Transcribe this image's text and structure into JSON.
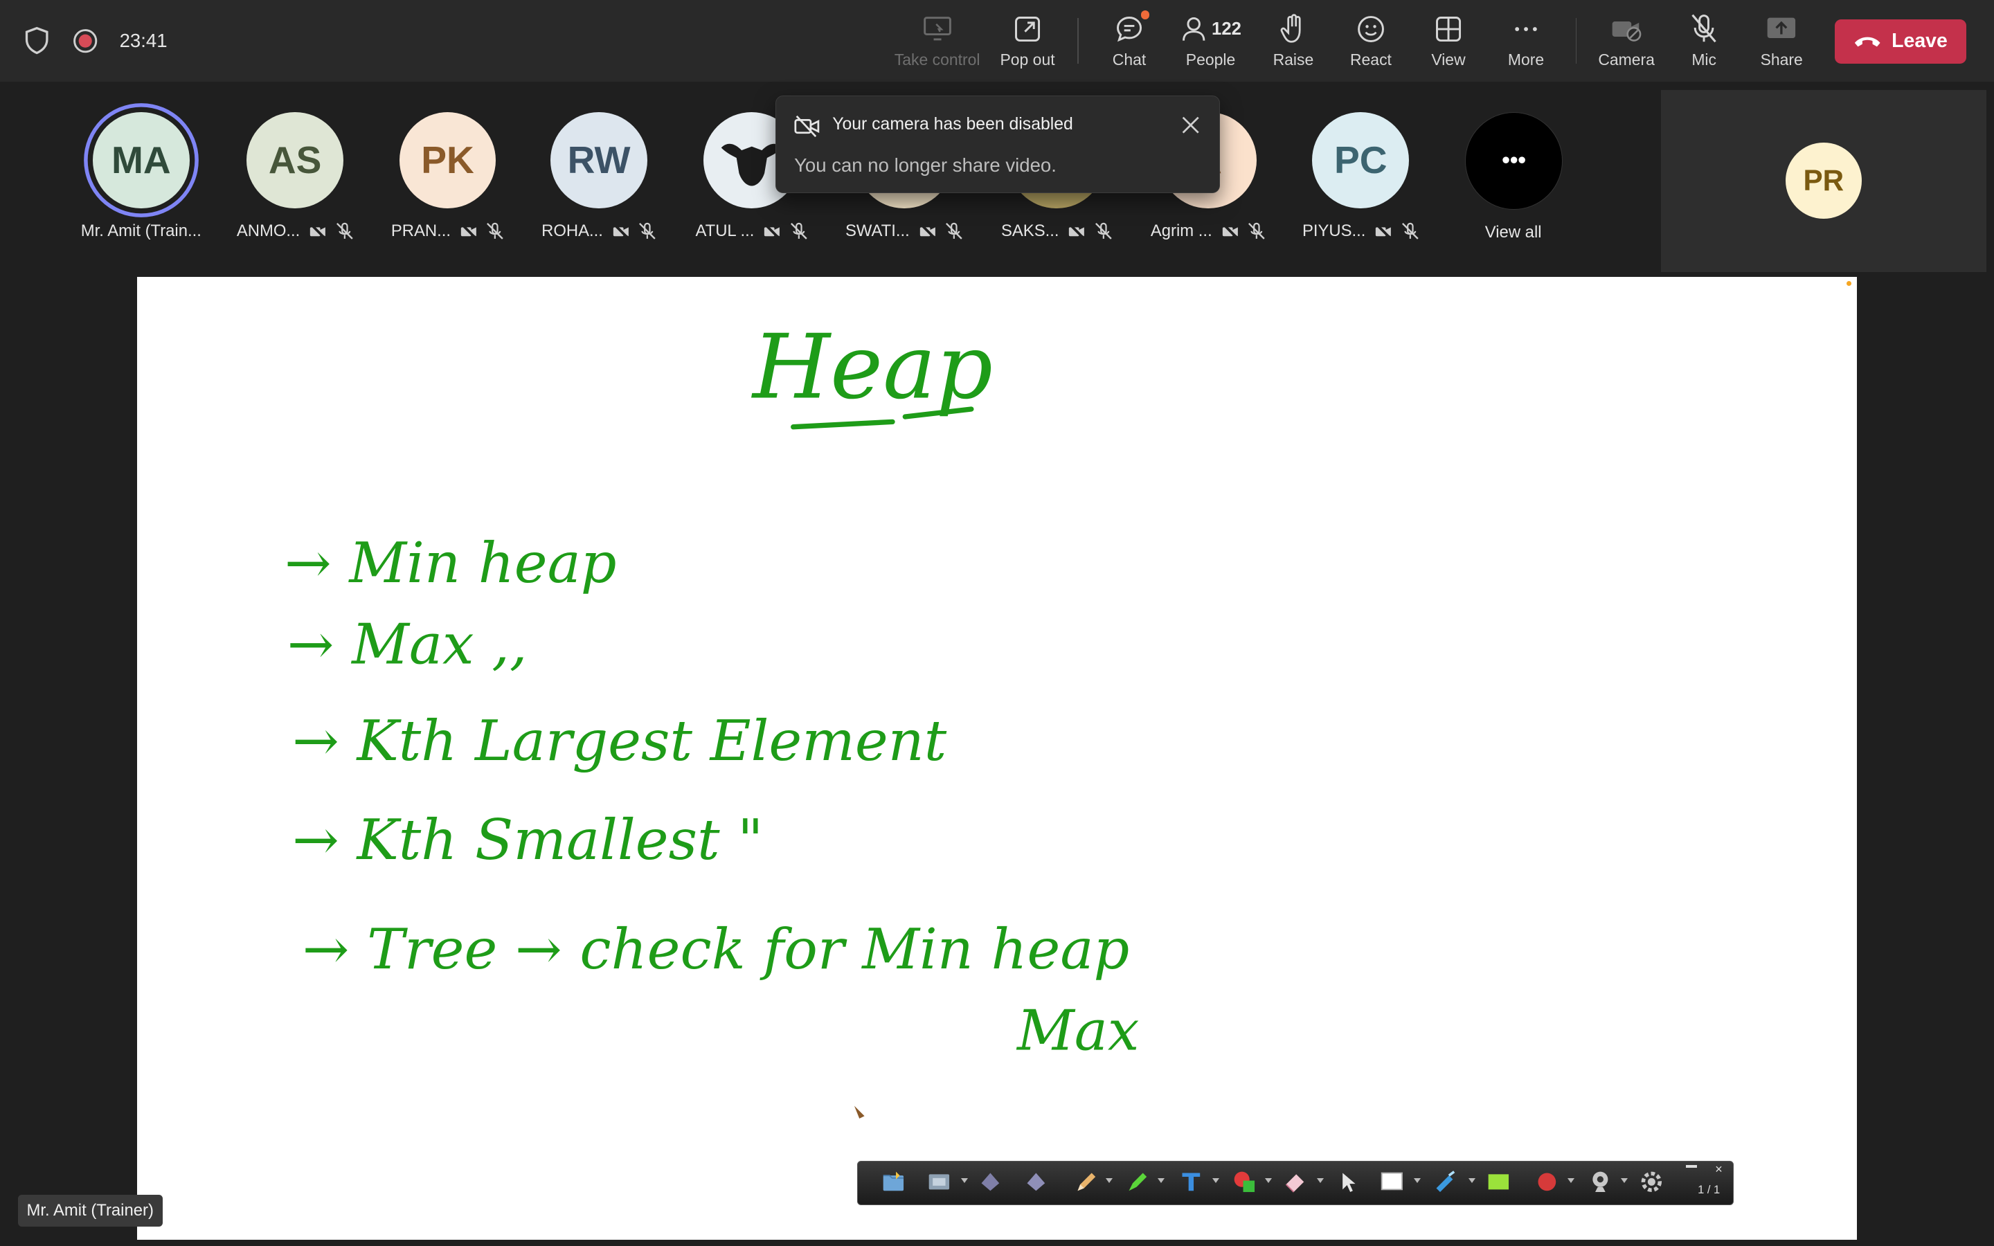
{
  "status": {
    "timer": "23:41"
  },
  "toolbar": {
    "take_control": "Take control",
    "pop_out": "Pop out",
    "chat": "Chat",
    "people": "People",
    "people_count": "122",
    "raise": "Raise",
    "react": "React",
    "view": "View",
    "more": "More",
    "camera": "Camera",
    "mic": "Mic",
    "share": "Share",
    "leave": "Leave"
  },
  "participants": [
    {
      "initials": "MA",
      "name": "Mr. Amit (Train...",
      "bg": "#d6e8dc",
      "fg": "#2f4a3a"
    },
    {
      "initials": "AS",
      "name": "ANMO...",
      "bg": "#dfe6d5",
      "fg": "#47563a"
    },
    {
      "initials": "PK",
      "name": "PRAN...",
      "bg": "#f9e6d5",
      "fg": "#8a5a2a"
    },
    {
      "initials": "RW",
      "name": "ROHA...",
      "bg": "#dde6ee",
      "fg": "#3c5266"
    },
    {
      "initials": "",
      "name": "ATUL ...",
      "bg": "#e8eef2",
      "fg": "#222"
    },
    {
      "initials": "",
      "name": "SWATI...",
      "bg": "#f2e3c6",
      "fg": "#222"
    },
    {
      "initials": "",
      "name": "SAKS...",
      "bg": "#b7a564",
      "fg": "#222"
    },
    {
      "initials": "A",
      "name": "Agrim ...",
      "bg": "#fbe1cc",
      "fg": "#8a5a2a"
    },
    {
      "initials": "PC",
      "name": "PIYUS...",
      "bg": "#dcedf2",
      "fg": "#3c6470"
    }
  ],
  "view_all": {
    "label": "View all",
    "dots": "•••"
  },
  "self_view": {
    "initials": "PR"
  },
  "toast": {
    "title": "Your camera has been disabled",
    "body": "You can no longer share video."
  },
  "whiteboard": {
    "title": "Heap",
    "lines": [
      "→ Min heap",
      "→ Max   ,,",
      "→ Kth  Largest  Element",
      "→ Kth  Smallest    \"",
      "→ Tree  →   check for  Min heap",
      "Max"
    ]
  },
  "presenter_label": "Mr. Amit (Trainer)",
  "annotation_toolbar": {
    "page": "1 / 1"
  }
}
